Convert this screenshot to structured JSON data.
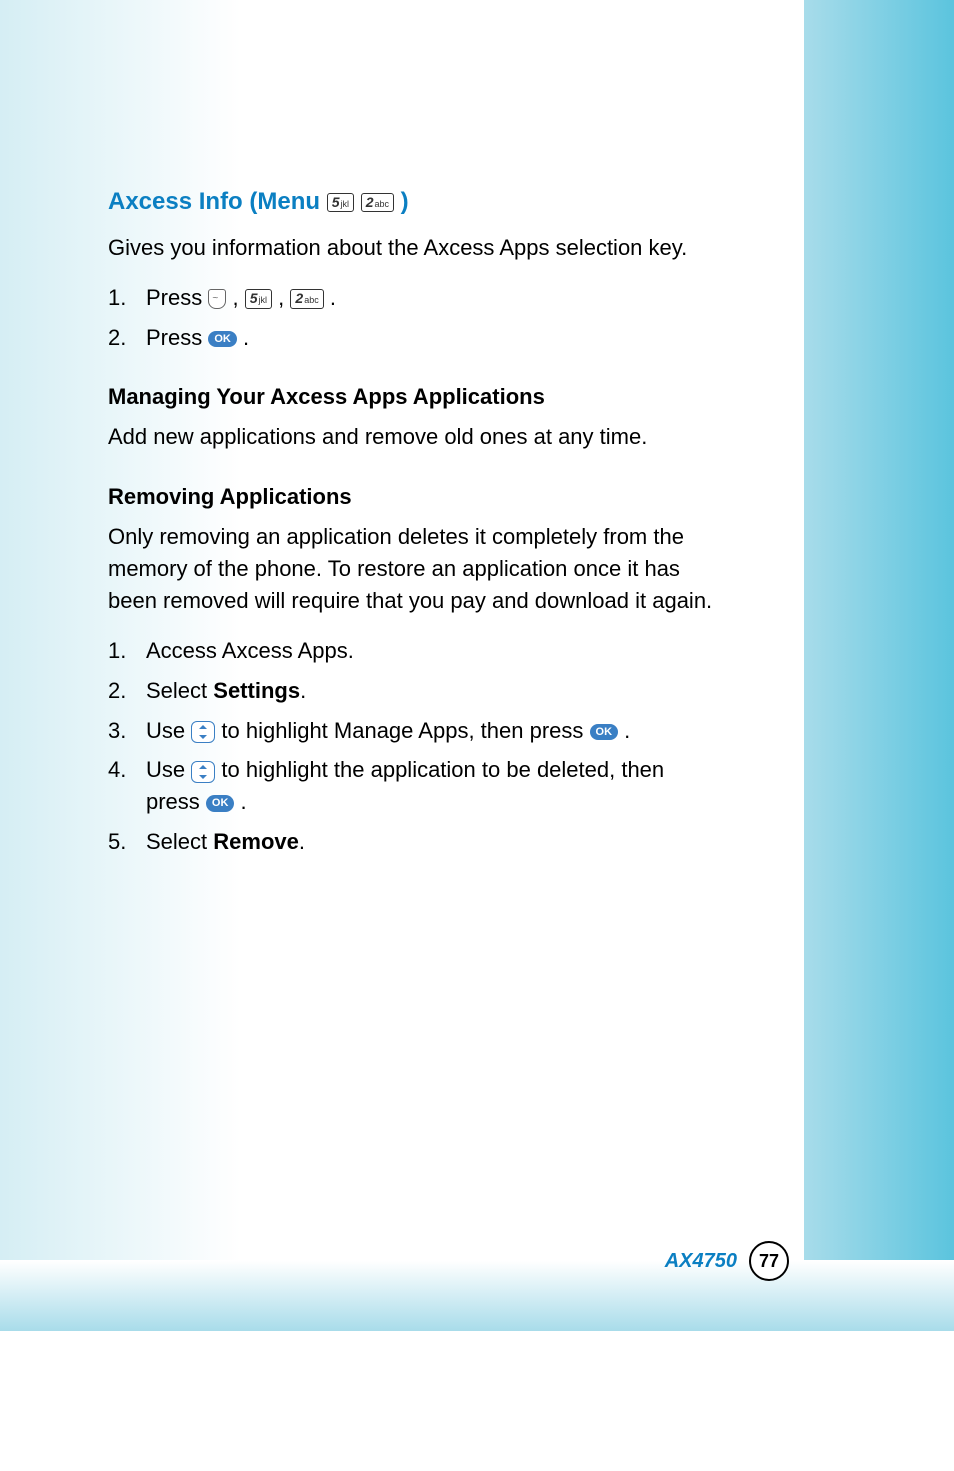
{
  "section": {
    "title_prefix": "Axcess Info (Menu",
    "title_suffix": ")",
    "key5": "5",
    "key5_sub": "jkl",
    "key2": "2",
    "key2_sub": "abc",
    "intro": "Gives you information about the Axcess Apps selection key."
  },
  "steps1": {
    "num1": "1.",
    "text1a": "Press",
    "text1b": ",",
    "text1c": ",",
    "text1d": ".",
    "num2": "2.",
    "text2a": "Press",
    "text2b": "."
  },
  "h1": "Managing Your Axcess Apps Applications",
  "p1": "Add new applications and remove old ones at any time.",
  "h2": "Removing Applications",
  "p2": "Only removing an application deletes it completely from the memory of the phone. To restore an application once it has been removed will require that you pay and download it again.",
  "steps2": {
    "num1": "1.",
    "t1": "Access Axcess Apps.",
    "num2": "2.",
    "t2a": "Select ",
    "t2b": "Settings",
    "t2c": ".",
    "num3": "3.",
    "t3a": "Use",
    "t3b": "to highlight Manage Apps, then press",
    "t3c": ".",
    "num4": "4.",
    "t4a": "Use",
    "t4b": "to highlight the application to be deleted, then press",
    "t4c": ".",
    "num5": "5.",
    "t5a": "Select ",
    "t5b": "Remove",
    "t5c": "."
  },
  "ok_label": "OK",
  "footer": {
    "model": "AX4750",
    "page": "77"
  }
}
